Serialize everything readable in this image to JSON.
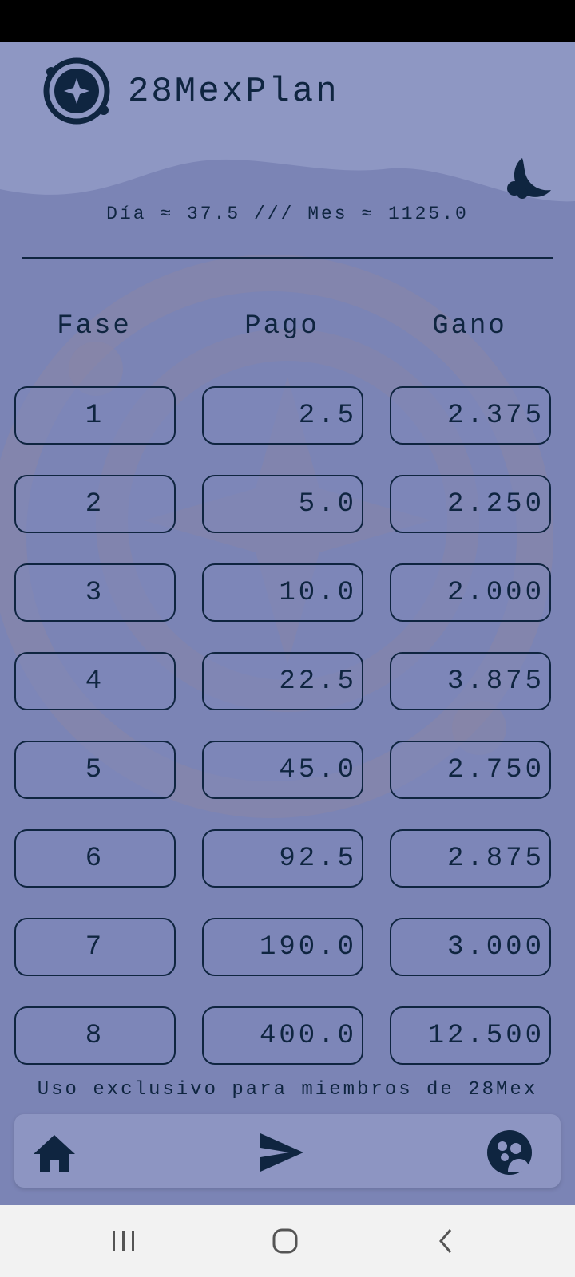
{
  "app": {
    "title": "28MexPlan"
  },
  "summary": {
    "text": "Día ≈ 37.5 /// Mes ≈ 1125.0"
  },
  "table": {
    "headers": [
      "Fase",
      "Pago",
      "Gano"
    ],
    "rows": [
      {
        "fase": "1",
        "pago": "2.5",
        "gano": "2.375"
      },
      {
        "fase": "2",
        "pago": "5.0",
        "gano": "2.250"
      },
      {
        "fase": "3",
        "pago": "10.0",
        "gano": "2.000"
      },
      {
        "fase": "4",
        "pago": "22.5",
        "gano": "3.875"
      },
      {
        "fase": "5",
        "pago": "45.0",
        "gano": "2.750"
      },
      {
        "fase": "6",
        "pago": "92.5",
        "gano": "2.875"
      },
      {
        "fase": "7",
        "pago": "190.0",
        "gano": "3.000"
      },
      {
        "fase": "8",
        "pago": "400.0",
        "gano": "12.500"
      }
    ]
  },
  "footer": {
    "note": "Uso exclusivo para miembros de 28Mex"
  },
  "icons": {
    "logo": "orbit-star-logo",
    "theme_toggle": "moon-icon",
    "nav": [
      "home-icon",
      "send-icon",
      "group-icon"
    ],
    "system_nav": [
      "recent-apps-icon",
      "home-circle-icon",
      "back-icon"
    ]
  },
  "colors": {
    "background": "#7b84b5",
    "header": "#8e97c3",
    "text": "#0f2540",
    "nav_bar": "#8d95c2",
    "system_bar": "#f2f2f2"
  }
}
